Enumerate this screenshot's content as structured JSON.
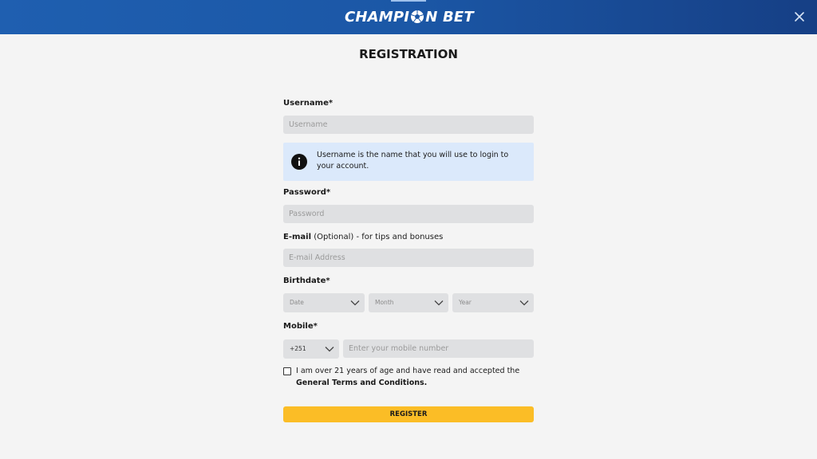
{
  "header": {
    "brand_left": "CHAMPI",
    "brand_right": "N BET",
    "brand_icon": "soccer-ball-icon",
    "close_icon": "close-icon",
    "colors": {
      "bar_start": "#1f5fb0",
      "bar_end": "#163f85"
    }
  },
  "form": {
    "title": "REGISTRATION",
    "username": {
      "label": "Username*",
      "placeholder": "Username"
    },
    "info": {
      "icon": "info-icon",
      "text": "Username is the name that you will use to login to your account."
    },
    "password": {
      "label": "Password*",
      "placeholder": "Password"
    },
    "email": {
      "label_bold": "E-mail",
      "label_rest": " (Optional) - for tips and bonuses",
      "placeholder": "E-mail Address"
    },
    "birthdate": {
      "label": "Birthdate*",
      "date": "Date",
      "month": "Month",
      "year": "Year"
    },
    "mobile": {
      "label": "Mobile*",
      "country_code": "+251",
      "placeholder": "Enter your mobile number"
    },
    "terms": {
      "text": "I am over 21 years of age and have read and accepted the ",
      "link": "General Terms and Conditions."
    },
    "submit_label": "REGISTER",
    "colors": {
      "submit": "#fbbd26",
      "info_bg": "#dbe9fb",
      "field_bg": "#dfe0e2"
    }
  }
}
